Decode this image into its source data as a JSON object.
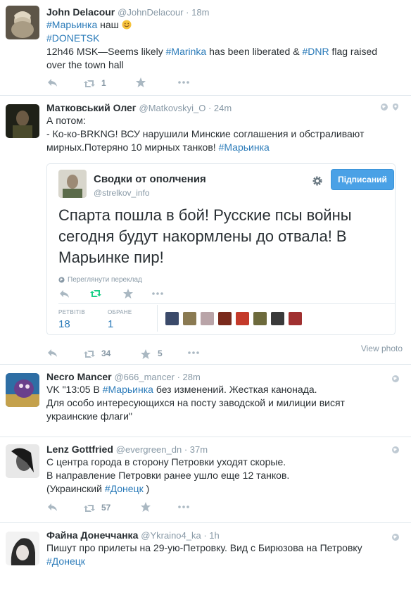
{
  "tweets": [
    {
      "fullname": "John Delacour",
      "handle": "@JohnDelacour",
      "time": "18m",
      "lines": [
        [
          {
            "t": "#Марьинка",
            "h": true
          },
          {
            "t": " наш "
          }
        ],
        [
          {
            "t": "#DONETSK",
            "h": true
          }
        ],
        [
          {
            "t": "12h46 MSK—Seems likely "
          },
          {
            "t": "#Marinka",
            "h": true
          },
          {
            "t": " has been liberated & "
          },
          {
            "t": "#DNR",
            "h": true
          },
          {
            "t": " flag raised"
          }
        ],
        [
          {
            "t": "over the town hall"
          }
        ]
      ],
      "retweets": "1",
      "favorites": ""
    },
    {
      "fullname": "Матковський Олег",
      "handle": "@Matkovskyi_O",
      "time": "24m",
      "lines": [
        [
          {
            "t": "А потом:"
          }
        ],
        [
          {
            "t": "- Ко-ко-BRKNG! ВСУ нарушили Минские соглашения и обстраливают"
          }
        ],
        [
          {
            "t": "мирных.Потеряно 10 мирных танков! "
          },
          {
            "t": "#Марьинка",
            "h": true
          }
        ]
      ],
      "retweets": "34",
      "favorites": "5",
      "view_photo": "View photo",
      "card": {
        "name": "Сводки от ополчения",
        "handle": "@strelkov_info",
        "follow_label": "Підписаний",
        "text_lines": [
          "Спарта пошла в бой! Русские псы войны",
          "сегодня будут накормлены до отвала! В",
          "Марьинке  пир!"
        ],
        "translate": "Переглянути переклад",
        "retweets_label": "РЕТВІТІВ",
        "retweets_value": "18",
        "favorites_label": "ОБРАНЕ",
        "favorites_value": "1"
      }
    },
    {
      "fullname": "Necro Mancer",
      "handle": "@666_mancer",
      "time": "28m",
      "lines": [
        [
          {
            "t": "VK \"13:05 В "
          },
          {
            "t": "#Марьинка",
            "h": true
          },
          {
            "t": " без изменений. Жесткая канонада."
          }
        ],
        [
          {
            "t": "Для особо интересующихся на посту заводской и милиции висят"
          }
        ],
        [
          {
            "t": "украинские флаги\""
          }
        ]
      ]
    },
    {
      "fullname": "Lenz Gottfried",
      "handle": "@evergreen_dn",
      "time": "37m",
      "lines": [
        [
          {
            "t": "С центра города в сторону Петровки уходят скорые."
          }
        ],
        [
          {
            "t": "В направление Петровки ранее ушло еще 12 танков."
          }
        ],
        [
          {
            "t": "(Украинский "
          },
          {
            "t": "#Донецк",
            "h": true
          },
          {
            "t": " )"
          }
        ]
      ],
      "retweets": "57",
      "favorites": ""
    },
    {
      "fullname": "Файна Донеччанка",
      "handle": "@Ykraino4_ka",
      "time": "1h",
      "lines": [
        [
          {
            "t": "Пишут про прилеты на 29-ую-Петровку. Вид с Бирюзова на Петровку"
          }
        ],
        [
          {
            "t": "#Донецк",
            "h": true
          }
        ]
      ]
    }
  ],
  "colors": {
    "hashtag": "#2b7bb9",
    "muted": "#8899a6",
    "follow_button": "#4aa1e6",
    "retweet_active": "#19cf86",
    "border": "#e1e8ed"
  }
}
